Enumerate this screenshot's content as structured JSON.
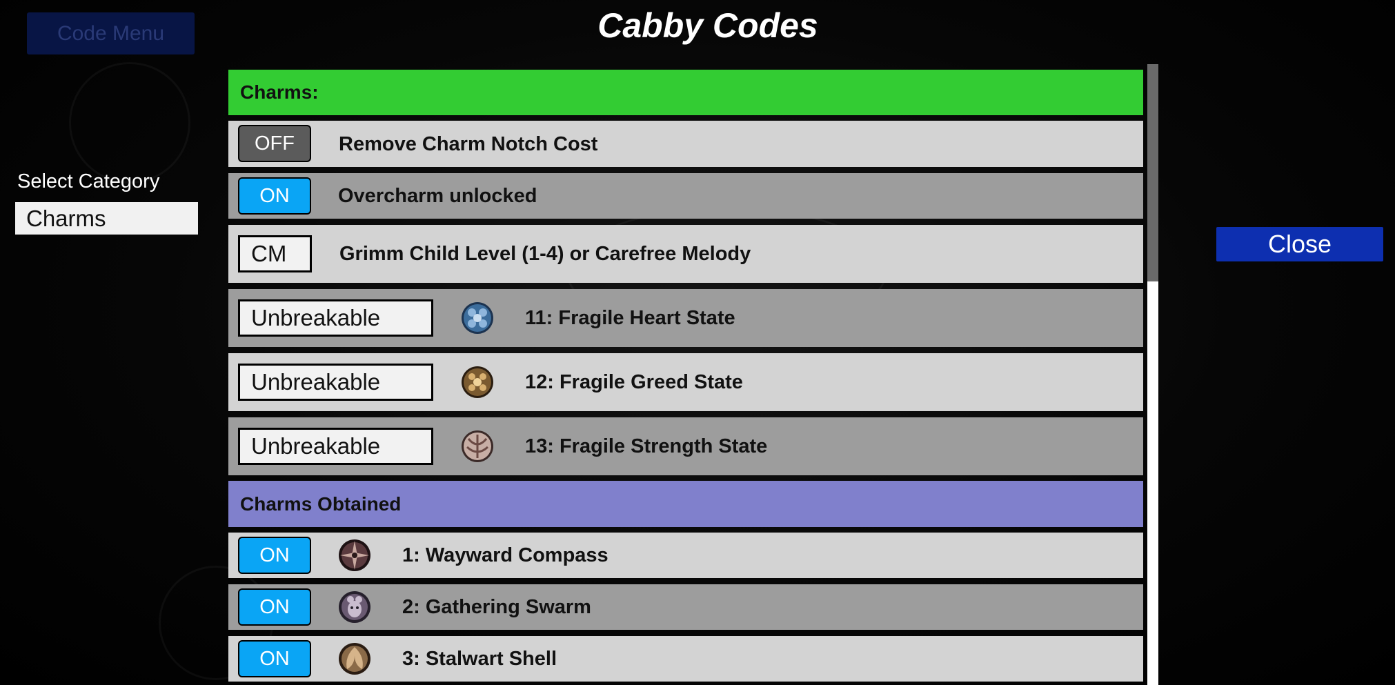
{
  "app": {
    "title": "Cabby Codes",
    "code_menu_label": "Code Menu",
    "close_label": "Close"
  },
  "sidebar": {
    "category_label": "Select Category",
    "category_value": "Charms"
  },
  "sections": {
    "charms": {
      "header": "Charms:",
      "header_color": "#33cc33",
      "rows": [
        {
          "control": "OFF",
          "label": "Remove Charm Notch Cost"
        },
        {
          "control": "ON",
          "label": "Overcharm unlocked"
        },
        {
          "control": "CM",
          "label": "Grimm Child Level (1-4) or Carefree Melody"
        },
        {
          "control": "Unbreakable",
          "label": "11: Fragile Heart State",
          "icon": "fragile-heart-icon"
        },
        {
          "control": "Unbreakable",
          "label": "12: Fragile Greed State",
          "icon": "fragile-greed-icon"
        },
        {
          "control": "Unbreakable",
          "label": "13: Fragile Strength State",
          "icon": "fragile-strength-icon"
        }
      ]
    },
    "obtained": {
      "header": "Charms Obtained",
      "header_color": "#8080cc",
      "rows": [
        {
          "control": "ON",
          "label": "1: Wayward Compass",
          "icon": "wayward-compass-icon"
        },
        {
          "control": "ON",
          "label": "2: Gathering Swarm",
          "icon": "gathering-swarm-icon"
        },
        {
          "control": "ON",
          "label": "3: Stalwart Shell",
          "icon": "stalwart-shell-icon"
        }
      ]
    }
  },
  "colors": {
    "toggle_on": "#0aa5f5",
    "toggle_off": "#5b5b5b",
    "close_button": "#0d2fb0",
    "row_light": "#d3d3d3",
    "row_dark": "#9d9d9d"
  }
}
